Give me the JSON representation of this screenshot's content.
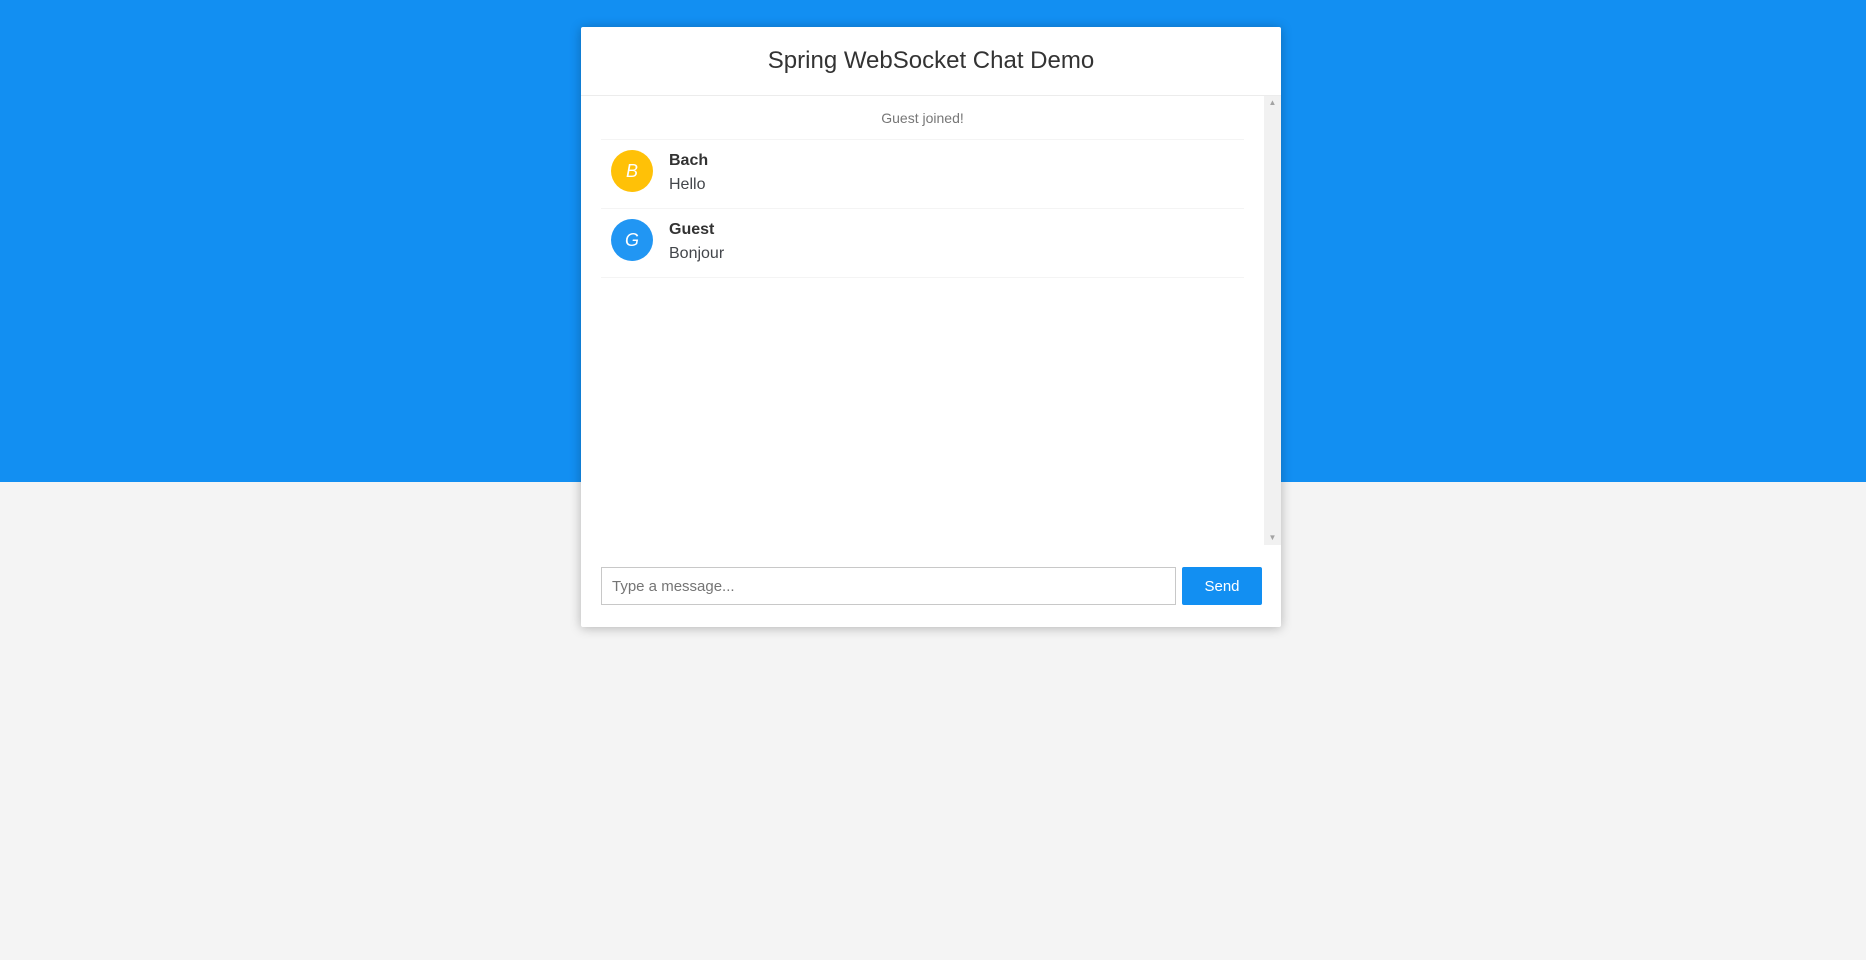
{
  "app": {
    "title": "Spring WebSocket Chat Demo"
  },
  "colors": {
    "brand": "#128ff2",
    "background": "#f4f4f4"
  },
  "messages": {
    "event": "Guest joined!",
    "chat": [
      {
        "avatar": "B",
        "sender": "Bach",
        "content": "Hello",
        "avatar_color": "#ffc107"
      },
      {
        "avatar": "G",
        "sender": "Guest",
        "content": "Bonjour",
        "avatar_color": "#2196f3"
      }
    ]
  },
  "composer": {
    "placeholder": "Type a message...",
    "value": "",
    "send_label": "Send"
  },
  "icons": {
    "scroll_up": "scroll-up-arrow-icon",
    "scroll_down": "scroll-down-arrow-icon"
  }
}
